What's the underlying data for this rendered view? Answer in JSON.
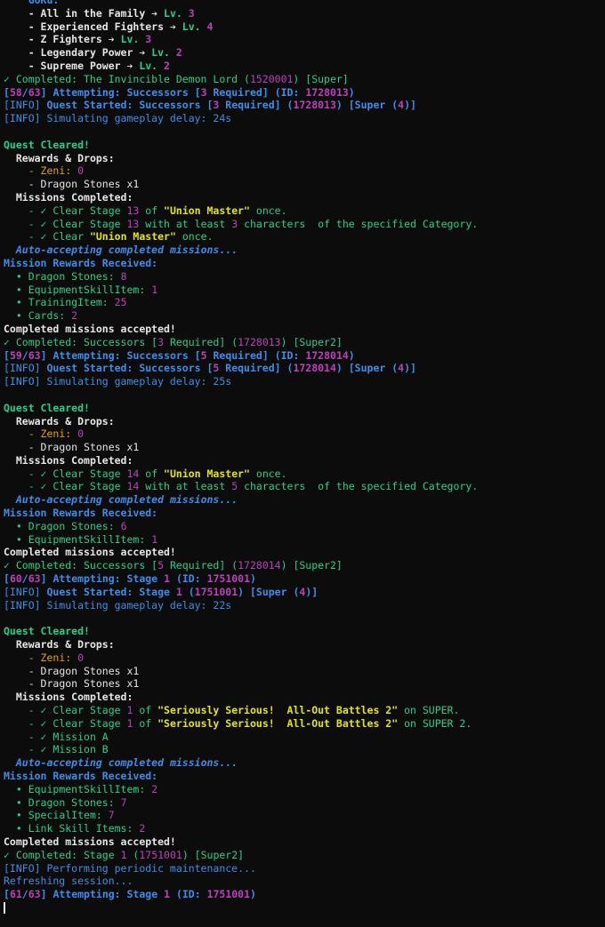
{
  "palette": {
    "white": "#e6e6e6",
    "green": "#23d18b",
    "blue": "#3b8eea",
    "magenta": "#bc3fbc",
    "yellow": "#e5e510",
    "cyan": "#29b8db",
    "orange": "#e5a00d"
  },
  "lines": [
    {
      "indent": "    ",
      "spans": [
        {
          "t": "GoKu:",
          "c": "blue",
          "b": true
        }
      ]
    },
    {
      "indent": "    ",
      "spans": [
        {
          "t": "- All in the Family ➔ ",
          "c": "white",
          "b": true
        },
        {
          "t": "Lv. ",
          "c": "green",
          "b": true
        },
        {
          "t": "3",
          "c": "magenta",
          "b": true
        }
      ]
    },
    {
      "indent": "    ",
      "spans": [
        {
          "t": "- Experienced Fighters ➔ ",
          "c": "white",
          "b": true
        },
        {
          "t": "Lv. ",
          "c": "green",
          "b": true
        },
        {
          "t": "4",
          "c": "magenta",
          "b": true
        }
      ]
    },
    {
      "indent": "    ",
      "spans": [
        {
          "t": "- Z Fighters ➔ ",
          "c": "white",
          "b": true
        },
        {
          "t": "Lv. ",
          "c": "green",
          "b": true
        },
        {
          "t": "3",
          "c": "magenta",
          "b": true
        }
      ]
    },
    {
      "indent": "    ",
      "spans": [
        {
          "t": "- Legendary Power ➔ ",
          "c": "white",
          "b": true
        },
        {
          "t": "Lv. ",
          "c": "green",
          "b": true
        },
        {
          "t": "2",
          "c": "magenta",
          "b": true
        }
      ]
    },
    {
      "indent": "    ",
      "spans": [
        {
          "t": "- Supreme Power ➔ ",
          "c": "white",
          "b": true
        },
        {
          "t": "Lv. ",
          "c": "green",
          "b": true
        },
        {
          "t": "2",
          "c": "magenta",
          "b": true
        }
      ]
    },
    {
      "indent": "",
      "spans": [
        {
          "t": "✓ Completed: The Invincible Demon Lord (",
          "c": "green"
        },
        {
          "t": "1520001",
          "c": "magenta"
        },
        {
          "t": ") [Super]",
          "c": "green"
        }
      ]
    },
    {
      "indent": "",
      "spans": [
        {
          "t": "[",
          "c": "blue",
          "b": true
        },
        {
          "t": "58",
          "c": "magenta",
          "b": true
        },
        {
          "t": "/",
          "c": "blue",
          "b": true
        },
        {
          "t": "63",
          "c": "magenta",
          "b": true
        },
        {
          "t": "] Attempting: Successors [",
          "c": "blue",
          "b": true
        },
        {
          "t": "3",
          "c": "magenta",
          "b": true
        },
        {
          "t": " Required] (ID: ",
          "c": "blue",
          "b": true
        },
        {
          "t": "1728013",
          "c": "magenta",
          "b": true
        },
        {
          "t": ")",
          "c": "blue",
          "b": true
        }
      ]
    },
    {
      "indent": "",
      "spans": [
        {
          "t": "[INFO] ",
          "c": "blue"
        },
        {
          "t": "Quest Started: Successors [",
          "c": "blue",
          "b": true
        },
        {
          "t": "3",
          "c": "magenta",
          "b": true
        },
        {
          "t": " Required] (",
          "c": "blue",
          "b": true
        },
        {
          "t": "1728013",
          "c": "magenta",
          "b": true
        },
        {
          "t": ") [Super (",
          "c": "blue",
          "b": true
        },
        {
          "t": "4",
          "c": "magenta",
          "b": true
        },
        {
          "t": ")]",
          "c": "blue",
          "b": true
        }
      ]
    },
    {
      "indent": "",
      "spans": [
        {
          "t": "[INFO] Simulating gameplay delay: 24s",
          "c": "blue"
        }
      ]
    },
    {
      "indent": "",
      "spans": []
    },
    {
      "indent": "",
      "spans": [
        {
          "t": "Quest Cleared!",
          "c": "green",
          "b": true
        }
      ]
    },
    {
      "indent": "  ",
      "spans": [
        {
          "t": "Rewards & Drops:",
          "c": "white",
          "b": true
        }
      ]
    },
    {
      "indent": "    ",
      "spans": [
        {
          "t": "- Zeni: ",
          "c": "orange"
        },
        {
          "t": "0",
          "c": "magenta"
        }
      ]
    },
    {
      "indent": "    ",
      "spans": [
        {
          "t": "- Dragon Stones x1",
          "c": "white"
        }
      ]
    },
    {
      "indent": "  ",
      "spans": [
        {
          "t": "Missions Completed:",
          "c": "white",
          "b": true
        }
      ]
    },
    {
      "indent": "    ",
      "spans": [
        {
          "t": "- ✓ Clear Stage ",
          "c": "green"
        },
        {
          "t": "13",
          "c": "magenta"
        },
        {
          "t": " of ",
          "c": "green"
        },
        {
          "t": "\"Union Master\"",
          "c": "yellow",
          "b": true
        },
        {
          "t": " once.",
          "c": "green"
        }
      ]
    },
    {
      "indent": "    ",
      "spans": [
        {
          "t": "- ✓ Clear Stage ",
          "c": "green"
        },
        {
          "t": "13",
          "c": "magenta"
        },
        {
          "t": " with at least ",
          "c": "green"
        },
        {
          "t": "3",
          "c": "magenta"
        },
        {
          "t": " characters  of the specified Category.",
          "c": "green"
        }
      ]
    },
    {
      "indent": "    ",
      "spans": [
        {
          "t": "- ✓ Clear ",
          "c": "green"
        },
        {
          "t": "\"Union Master\"",
          "c": "yellow",
          "b": true
        },
        {
          "t": " once.",
          "c": "green"
        }
      ]
    },
    {
      "indent": "  ",
      "spans": [
        {
          "t": "Auto-accepting completed missions...",
          "c": "blue",
          "i": true
        }
      ]
    },
    {
      "indent": "",
      "spans": [
        {
          "t": "Mission Rewards Received:",
          "c": "blue",
          "b": true
        }
      ]
    },
    {
      "indent": "  ",
      "spans": [
        {
          "t": "• Dragon Stones: ",
          "c": "green"
        },
        {
          "t": "8",
          "c": "magenta"
        }
      ]
    },
    {
      "indent": "  ",
      "spans": [
        {
          "t": "• EquipmentSkillItem: ",
          "c": "green"
        },
        {
          "t": "1",
          "c": "magenta"
        }
      ]
    },
    {
      "indent": "  ",
      "spans": [
        {
          "t": "• TrainingItem: ",
          "c": "green"
        },
        {
          "t": "25",
          "c": "magenta"
        }
      ]
    },
    {
      "indent": "  ",
      "spans": [
        {
          "t": "• Cards: ",
          "c": "green"
        },
        {
          "t": "2",
          "c": "magenta"
        }
      ]
    },
    {
      "indent": "",
      "spans": [
        {
          "t": "Completed missions accepted!",
          "c": "white",
          "b": true
        }
      ]
    },
    {
      "indent": "",
      "spans": [
        {
          "t": "✓ Completed: Successors [",
          "c": "green"
        },
        {
          "t": "3",
          "c": "magenta"
        },
        {
          "t": " Required] (",
          "c": "green"
        },
        {
          "t": "1728013",
          "c": "magenta"
        },
        {
          "t": ") [Super2]",
          "c": "green"
        }
      ]
    },
    {
      "indent": "",
      "spans": [
        {
          "t": "[",
          "c": "blue",
          "b": true
        },
        {
          "t": "59",
          "c": "magenta",
          "b": true
        },
        {
          "t": "/",
          "c": "blue",
          "b": true
        },
        {
          "t": "63",
          "c": "magenta",
          "b": true
        },
        {
          "t": "] Attempting: Successors [",
          "c": "blue",
          "b": true
        },
        {
          "t": "5",
          "c": "magenta",
          "b": true
        },
        {
          "t": " Required] (ID: ",
          "c": "blue",
          "b": true
        },
        {
          "t": "1728014",
          "c": "magenta",
          "b": true
        },
        {
          "t": ")",
          "c": "blue",
          "b": true
        }
      ]
    },
    {
      "indent": "",
      "spans": [
        {
          "t": "[INFO] ",
          "c": "blue"
        },
        {
          "t": "Quest Started: Successors [",
          "c": "blue",
          "b": true
        },
        {
          "t": "5",
          "c": "magenta",
          "b": true
        },
        {
          "t": " Required] (",
          "c": "blue",
          "b": true
        },
        {
          "t": "1728014",
          "c": "magenta",
          "b": true
        },
        {
          "t": ") [Super (",
          "c": "blue",
          "b": true
        },
        {
          "t": "4",
          "c": "magenta",
          "b": true
        },
        {
          "t": ")]",
          "c": "blue",
          "b": true
        }
      ]
    },
    {
      "indent": "",
      "spans": [
        {
          "t": "[INFO] Simulating gameplay delay: 25s",
          "c": "blue"
        }
      ]
    },
    {
      "indent": "",
      "spans": []
    },
    {
      "indent": "",
      "spans": [
        {
          "t": "Quest Cleared!",
          "c": "green",
          "b": true
        }
      ]
    },
    {
      "indent": "  ",
      "spans": [
        {
          "t": "Rewards & Drops:",
          "c": "white",
          "b": true
        }
      ]
    },
    {
      "indent": "    ",
      "spans": [
        {
          "t": "- Zeni: ",
          "c": "orange"
        },
        {
          "t": "0",
          "c": "magenta"
        }
      ]
    },
    {
      "indent": "    ",
      "spans": [
        {
          "t": "- Dragon Stones x1",
          "c": "white"
        }
      ]
    },
    {
      "indent": "  ",
      "spans": [
        {
          "t": "Missions Completed:",
          "c": "white",
          "b": true
        }
      ]
    },
    {
      "indent": "    ",
      "spans": [
        {
          "t": "- ✓ Clear Stage ",
          "c": "green"
        },
        {
          "t": "14",
          "c": "magenta"
        },
        {
          "t": " of ",
          "c": "green"
        },
        {
          "t": "\"Union Master\"",
          "c": "yellow",
          "b": true
        },
        {
          "t": " once.",
          "c": "green"
        }
      ]
    },
    {
      "indent": "    ",
      "spans": [
        {
          "t": "- ✓ Clear Stage ",
          "c": "green"
        },
        {
          "t": "14",
          "c": "magenta"
        },
        {
          "t": " with at least ",
          "c": "green"
        },
        {
          "t": "5",
          "c": "magenta"
        },
        {
          "t": " characters  of the specified Category.",
          "c": "green"
        }
      ]
    },
    {
      "indent": "  ",
      "spans": [
        {
          "t": "Auto-accepting completed missions...",
          "c": "blue",
          "i": true
        }
      ]
    },
    {
      "indent": "",
      "spans": [
        {
          "t": "Mission Rewards Received:",
          "c": "blue",
          "b": true
        }
      ]
    },
    {
      "indent": "  ",
      "spans": [
        {
          "t": "• Dragon Stones: ",
          "c": "green"
        },
        {
          "t": "6",
          "c": "magenta"
        }
      ]
    },
    {
      "indent": "  ",
      "spans": [
        {
          "t": "• EquipmentSkillItem: ",
          "c": "green"
        },
        {
          "t": "1",
          "c": "magenta"
        }
      ]
    },
    {
      "indent": "",
      "spans": [
        {
          "t": "Completed missions accepted!",
          "c": "white",
          "b": true
        }
      ]
    },
    {
      "indent": "",
      "spans": [
        {
          "t": "✓ Completed: Successors [",
          "c": "green"
        },
        {
          "t": "5",
          "c": "magenta"
        },
        {
          "t": " Required] (",
          "c": "green"
        },
        {
          "t": "1728014",
          "c": "magenta"
        },
        {
          "t": ") [Super2]",
          "c": "green"
        }
      ]
    },
    {
      "indent": "",
      "spans": [
        {
          "t": "[",
          "c": "blue",
          "b": true
        },
        {
          "t": "60",
          "c": "magenta",
          "b": true
        },
        {
          "t": "/",
          "c": "blue",
          "b": true
        },
        {
          "t": "63",
          "c": "magenta",
          "b": true
        },
        {
          "t": "] Attempting: Stage ",
          "c": "blue",
          "b": true
        },
        {
          "t": "1",
          "c": "magenta",
          "b": true
        },
        {
          "t": " (ID: ",
          "c": "blue",
          "b": true
        },
        {
          "t": "1751001",
          "c": "magenta",
          "b": true
        },
        {
          "t": ")",
          "c": "blue",
          "b": true
        }
      ]
    },
    {
      "indent": "",
      "spans": [
        {
          "t": "[INFO] ",
          "c": "blue"
        },
        {
          "t": "Quest Started: Stage ",
          "c": "blue",
          "b": true
        },
        {
          "t": "1",
          "c": "magenta",
          "b": true
        },
        {
          "t": " (",
          "c": "blue",
          "b": true
        },
        {
          "t": "1751001",
          "c": "magenta",
          "b": true
        },
        {
          "t": ") [Super (",
          "c": "blue",
          "b": true
        },
        {
          "t": "4",
          "c": "magenta",
          "b": true
        },
        {
          "t": ")]",
          "c": "blue",
          "b": true
        }
      ]
    },
    {
      "indent": "",
      "spans": [
        {
          "t": "[INFO] Simulating gameplay delay: 22s",
          "c": "blue"
        }
      ]
    },
    {
      "indent": "",
      "spans": []
    },
    {
      "indent": "",
      "spans": [
        {
          "t": "Quest Cleared!",
          "c": "green",
          "b": true
        }
      ]
    },
    {
      "indent": "  ",
      "spans": [
        {
          "t": "Rewards & Drops:",
          "c": "white",
          "b": true
        }
      ]
    },
    {
      "indent": "    ",
      "spans": [
        {
          "t": "- Zeni: ",
          "c": "orange"
        },
        {
          "t": "0",
          "c": "magenta"
        }
      ]
    },
    {
      "indent": "    ",
      "spans": [
        {
          "t": "- Dragon Stones x1",
          "c": "white"
        }
      ]
    },
    {
      "indent": "    ",
      "spans": [
        {
          "t": "- Dragon Stones x1",
          "c": "white"
        }
      ]
    },
    {
      "indent": "  ",
      "spans": [
        {
          "t": "Missions Completed:",
          "c": "white",
          "b": true
        }
      ]
    },
    {
      "indent": "    ",
      "spans": [
        {
          "t": "- ✓ Clear Stage ",
          "c": "green"
        },
        {
          "t": "1",
          "c": "magenta"
        },
        {
          "t": " of ",
          "c": "green"
        },
        {
          "t": "\"Seriously Serious!  All-Out Battles 2\"",
          "c": "yellow",
          "b": true
        },
        {
          "t": " on SUPER.",
          "c": "green"
        }
      ]
    },
    {
      "indent": "    ",
      "spans": [
        {
          "t": "- ✓ Clear Stage ",
          "c": "green"
        },
        {
          "t": "1",
          "c": "magenta"
        },
        {
          "t": " of ",
          "c": "green"
        },
        {
          "t": "\"Seriously Serious!  All-Out Battles 2\"",
          "c": "yellow",
          "b": true
        },
        {
          "t": " on SUPER 2.",
          "c": "green"
        }
      ]
    },
    {
      "indent": "    ",
      "spans": [
        {
          "t": "- ✓ Mission A",
          "c": "green"
        }
      ]
    },
    {
      "indent": "    ",
      "spans": [
        {
          "t": "- ✓ Mission B",
          "c": "green"
        }
      ]
    },
    {
      "indent": "  ",
      "spans": [
        {
          "t": "Auto-accepting completed missions...",
          "c": "blue",
          "i": true
        }
      ]
    },
    {
      "indent": "",
      "spans": [
        {
          "t": "Mission Rewards Received:",
          "c": "blue",
          "b": true
        }
      ]
    },
    {
      "indent": "  ",
      "spans": [
        {
          "t": "• EquipmentSkillItem: ",
          "c": "green"
        },
        {
          "t": "2",
          "c": "magenta"
        }
      ]
    },
    {
      "indent": "  ",
      "spans": [
        {
          "t": "• Dragon Stones: ",
          "c": "green"
        },
        {
          "t": "7",
          "c": "magenta"
        }
      ]
    },
    {
      "indent": "  ",
      "spans": [
        {
          "t": "• SpecialItem: ",
          "c": "green"
        },
        {
          "t": "7",
          "c": "magenta"
        }
      ]
    },
    {
      "indent": "  ",
      "spans": [
        {
          "t": "• Link Skill Items: ",
          "c": "green"
        },
        {
          "t": "2",
          "c": "magenta"
        }
      ]
    },
    {
      "indent": "",
      "spans": [
        {
          "t": "Completed missions accepted!",
          "c": "white",
          "b": true
        }
      ]
    },
    {
      "indent": "",
      "spans": [
        {
          "t": "✓ Completed: Stage ",
          "c": "green"
        },
        {
          "t": "1",
          "c": "magenta"
        },
        {
          "t": " (",
          "c": "green"
        },
        {
          "t": "1751001",
          "c": "magenta"
        },
        {
          "t": ") [Super2]",
          "c": "green"
        }
      ]
    },
    {
      "indent": "",
      "spans": [
        {
          "t": "[INFO] Performing periodic maintenance...",
          "c": "blue"
        }
      ]
    },
    {
      "indent": "",
      "spans": [
        {
          "t": "Refreshing session...",
          "c": "blue"
        }
      ]
    },
    {
      "indent": "",
      "spans": [
        {
          "t": "[",
          "c": "blue",
          "b": true
        },
        {
          "t": "61",
          "c": "magenta",
          "b": true
        },
        {
          "t": "/",
          "c": "blue",
          "b": true
        },
        {
          "t": "63",
          "c": "magenta",
          "b": true
        },
        {
          "t": "] Attempting: Stage ",
          "c": "blue",
          "b": true
        },
        {
          "t": "1",
          "c": "magenta",
          "b": true
        },
        {
          "t": " (ID: ",
          "c": "blue",
          "b": true
        },
        {
          "t": "1751001",
          "c": "magenta",
          "b": true
        },
        {
          "t": ")",
          "c": "blue",
          "b": true
        }
      ]
    }
  ]
}
